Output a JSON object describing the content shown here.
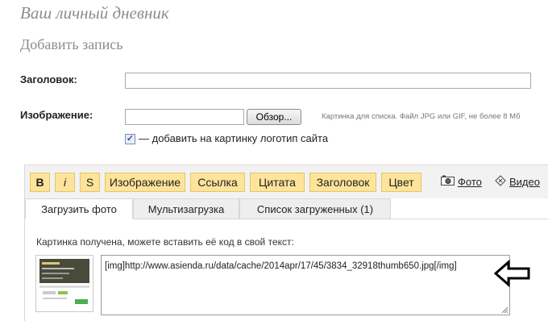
{
  "page": {
    "title": "Ваш личный дневник",
    "section_title": "Добавить запись"
  },
  "form": {
    "title_label": "Заголовок:",
    "title_value": "",
    "image_label": "Изображение:",
    "file_value": "",
    "browse_label": "Обзор...",
    "image_hint": "Картинка для списка. Файл JPG или GIF, не более 8 Мб",
    "logo_checkbox": {
      "checked": true,
      "label": "— добавить на картинку логотип сайта"
    }
  },
  "toolbar": {
    "buttons": [
      "B",
      "i",
      "S",
      "Изображение",
      "Ссылка",
      "Цитата",
      "Заголовок",
      "Цвет"
    ],
    "photo_link": "Фото",
    "video_link": "Видео"
  },
  "tabs": [
    {
      "label": "Загрузить фото",
      "active": true
    },
    {
      "label": "Мультизагрузка",
      "active": false
    },
    {
      "label": "Список загруженных (1)",
      "active": false
    }
  ],
  "upload": {
    "received_text": "Картинка получена, можете вставить её код в свой текст:",
    "code": "[img]http://www.asienda.ru/data/cache/2014apr/17/45/3834_32918thumb650.jpg[/img]"
  },
  "colors": {
    "toolbar_button_bg": "#fde49a",
    "toolbar_button_border": "#e5c565",
    "toolbar_bg": "#f2f2f2"
  },
  "icons": [
    "camera-icon",
    "video-icon",
    "arrow-left-icon",
    "checkmark-icon"
  ]
}
